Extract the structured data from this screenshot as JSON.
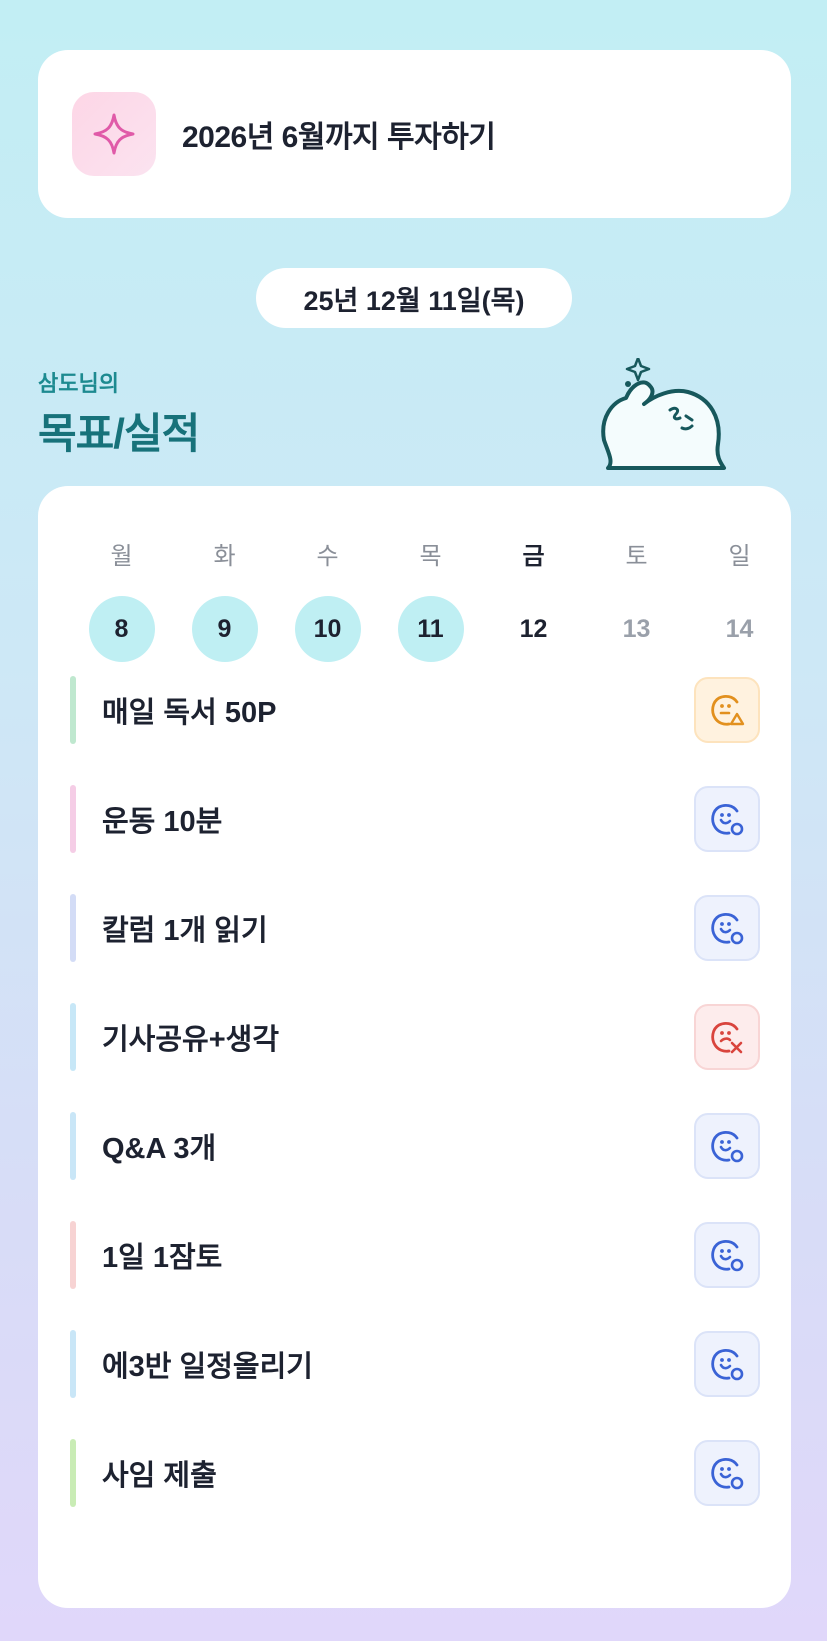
{
  "goal": {
    "text": "2026년 6월까지 투자하기",
    "icon": "sparkle-icon",
    "accent": "#e05aa8"
  },
  "date_label": "25년 12월 11일(목)",
  "owner_label": "삼도님의",
  "section_title": "목표/실적",
  "week": {
    "days_of_week": [
      "월",
      "화",
      "수",
      "목",
      "금",
      "토",
      "일"
    ],
    "dates": [
      "8",
      "9",
      "10",
      "11",
      "12",
      "13",
      "14"
    ]
  },
  "tasks": [
    {
      "label": "매일 독서 50P",
      "bar_color": "#bfe8cf",
      "status": "warn"
    },
    {
      "label": "운동 10분",
      "bar_color": "#f5cde6",
      "status": "ok"
    },
    {
      "label": "칼럼 1개 읽기",
      "bar_color": "#d3dcf6",
      "status": "ok"
    },
    {
      "label": "기사공유+생각",
      "bar_color": "#c7e7f7",
      "status": "fail"
    },
    {
      "label": "Q&A 3개",
      "bar_color": "#c9e6f7",
      "status": "ok"
    },
    {
      "label": "1일 1잠토",
      "bar_color": "#f7d3d3",
      "status": "ok"
    },
    {
      "label": "에3반 일정올리기",
      "bar_color": "#c9e6f7",
      "status": "ok"
    },
    {
      "label": "사임 제출",
      "bar_color": "#c9ecb5",
      "status": "ok"
    }
  ],
  "colors": {
    "ok": "#3a63d6",
    "warn": "#e2901e",
    "fail": "#d9443d",
    "teal": "#17727a"
  }
}
